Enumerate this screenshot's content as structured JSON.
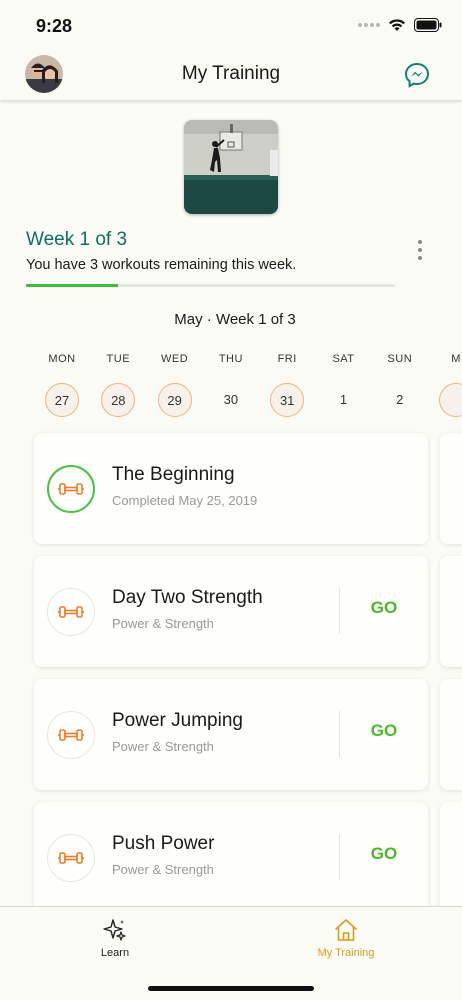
{
  "status_bar": {
    "time": "9:28"
  },
  "header": {
    "title": "My Training"
  },
  "week": {
    "title": "Week 1 of 3",
    "subtitle": "You have 3 workouts remaining this week.",
    "progress": 0.25
  },
  "calendar": {
    "heading": "May · Week 1 of 3",
    "days": [
      {
        "label": "MON",
        "date": "27",
        "completed": true
      },
      {
        "label": "TUE",
        "date": "28",
        "completed": true
      },
      {
        "label": "WED",
        "date": "29",
        "completed": true
      },
      {
        "label": "THU",
        "date": "30",
        "completed": false
      },
      {
        "label": "FRI",
        "date": "31",
        "completed": true
      },
      {
        "label": "SAT",
        "date": "1",
        "completed": false
      },
      {
        "label": "SUN",
        "date": "2",
        "completed": false
      },
      {
        "label": "M",
        "date": "",
        "completed": true
      }
    ]
  },
  "workouts": [
    {
      "title": "The Beginning",
      "subtitle": "Completed May 25, 2019",
      "status": "completed"
    },
    {
      "title": "Day Two Strength",
      "subtitle": "Power & Strength",
      "action": "GO"
    },
    {
      "title": "Power Jumping",
      "subtitle": "Power & Strength",
      "action": "GO"
    },
    {
      "title": "Push Power",
      "subtitle": "Power & Strength",
      "action": "GO"
    }
  ],
  "nav": {
    "items": [
      {
        "label": "Learn",
        "icon": "sparkle-icon",
        "active": false
      },
      {
        "label": "My Training",
        "icon": "home-icon",
        "active": true
      }
    ]
  },
  "colors": {
    "accent_green": "#3dbb3d",
    "title_teal": "#0e6e5e",
    "icon_orange": "#ee7b2c",
    "active_nav": "#d99a1a"
  }
}
